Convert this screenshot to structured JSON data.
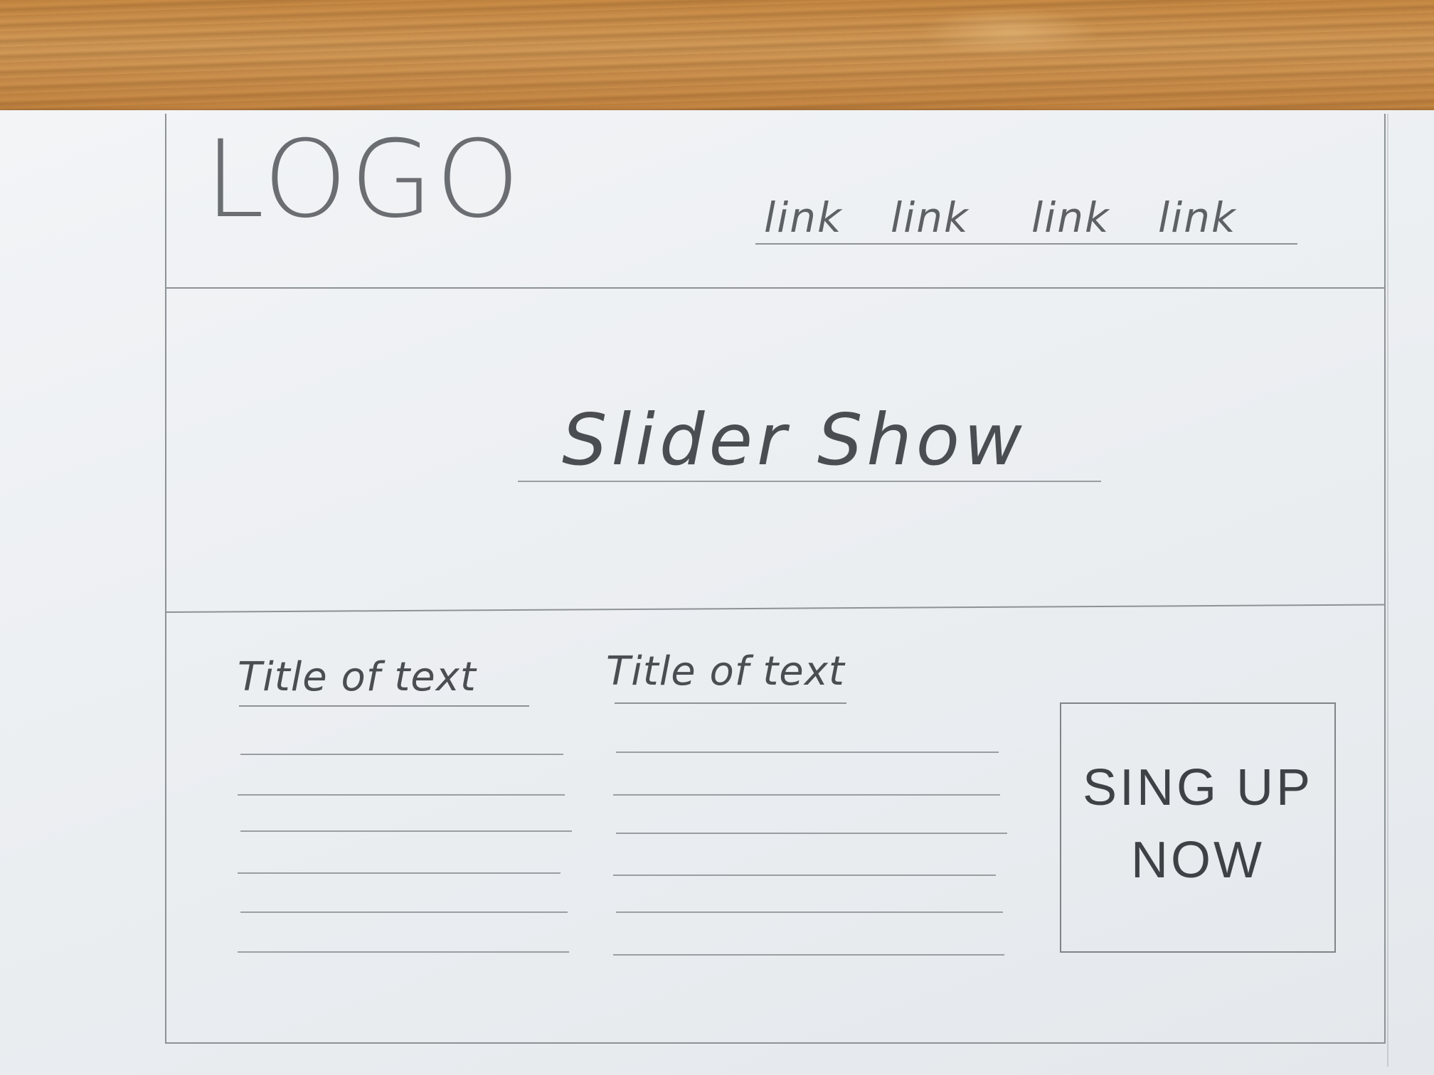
{
  "header": {
    "logo_text": "LOGO",
    "nav_links": [
      "link",
      "link",
      "link",
      "link"
    ]
  },
  "hero": {
    "label": "Slider Show"
  },
  "content": {
    "columns": [
      {
        "title": "Title of text",
        "line_count": 6
      },
      {
        "title": "Title of text",
        "line_count": 6
      }
    ]
  },
  "cta": {
    "line1": "SING UP",
    "line2": "NOW"
  }
}
